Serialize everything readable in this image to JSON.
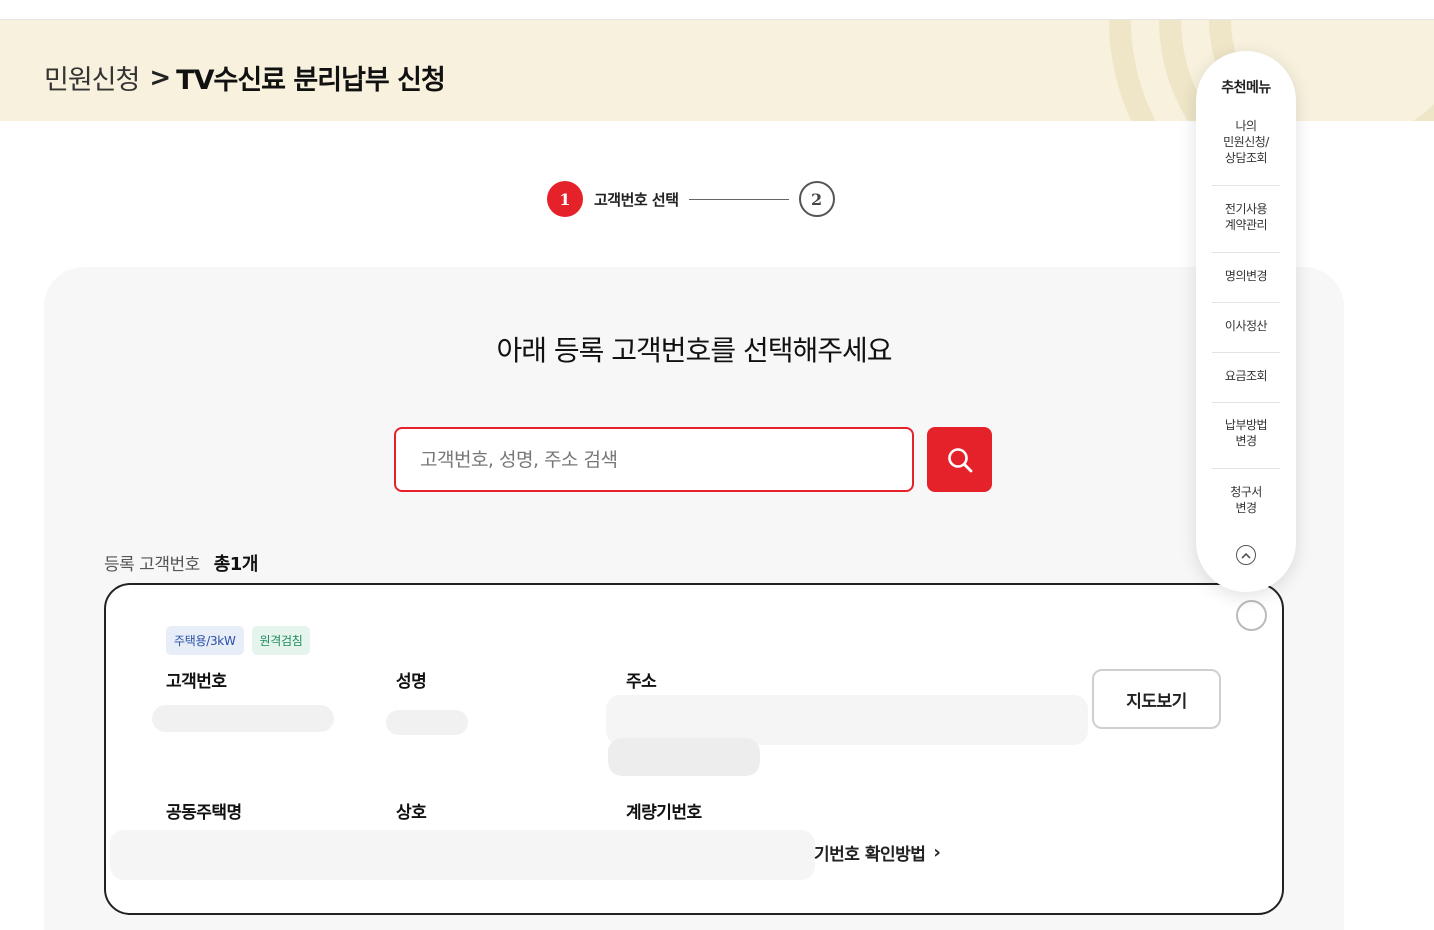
{
  "breadcrumb": {
    "parent": "민원신청",
    "separator": ">",
    "current": "TV수신료 분리납부 신청"
  },
  "stepper": {
    "steps": [
      {
        "number": "1",
        "label": "고객번호 선택"
      },
      {
        "number": "2"
      }
    ]
  },
  "main": {
    "title": "아래 등록 고객번호를 선택해주세요",
    "search": {
      "placeholder": "고객번호, 성명, 주소 검색",
      "value": ""
    },
    "count_label": "등록 고객번호",
    "count_value": "총1개"
  },
  "card": {
    "badges": [
      "주택용/3kW",
      "원격검침"
    ],
    "fields": {
      "customer_number": "고객번호",
      "name": "성명",
      "address": "주소",
      "apartment": "공동주택명",
      "business": "상호",
      "meter": "계량기번호"
    },
    "map_button": "지도보기",
    "meter_help_link": "기번호 확인방법"
  },
  "quickmenu": {
    "title": "추천메뉴",
    "items": [
      "나의\n민원신청/\n상담조회",
      "전기사용\n계약관리",
      "명의변경",
      "이사정산",
      "요금조회",
      "납부방법\n변경",
      "청구서\n변경"
    ]
  },
  "colors": {
    "accent": "#e5222a",
    "banner": "#f7f1de",
    "panel": "#f7f7f7"
  }
}
